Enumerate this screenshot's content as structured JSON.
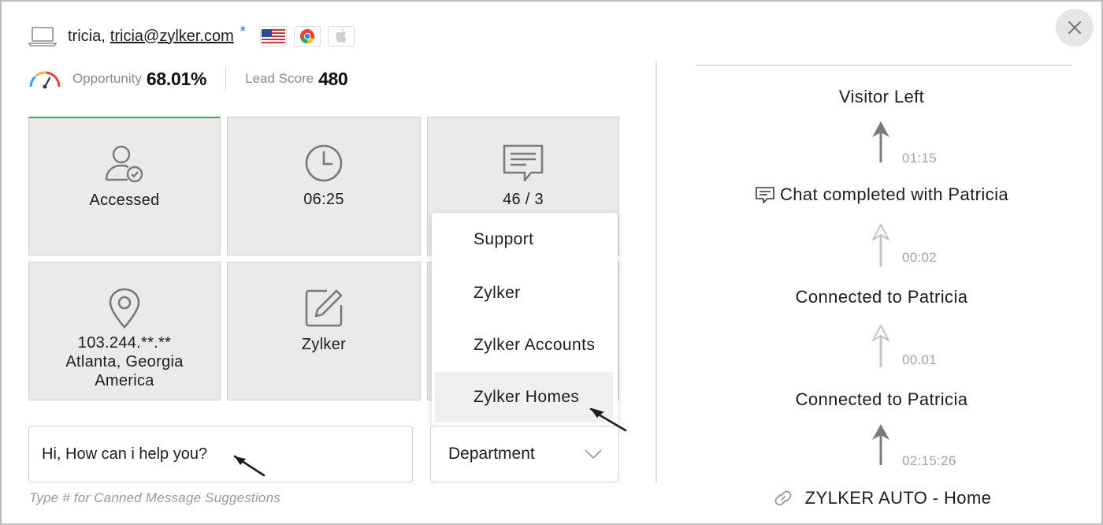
{
  "visitor": {
    "name": "tricia,",
    "email": "tricia@zylker.com",
    "star": "*",
    "icons": [
      "laptop-icon",
      "us-flag-icon",
      "chrome-icon",
      "apple-icon"
    ]
  },
  "metrics": {
    "opportunity_label": "Opportunity",
    "opportunity_value": "68.01%",
    "lead_score_label": "Lead Score",
    "lead_score_value": "480"
  },
  "tiles": [
    {
      "icon": "user-check-icon",
      "text": "Accessed"
    },
    {
      "icon": "clock-icon",
      "text": "06:25"
    },
    {
      "icon": "chat-icon",
      "text": "46 / 3"
    },
    {
      "icon": "location-pin-icon",
      "lines": [
        "103.244.**.**",
        "Atlanta, Georgia",
        "America"
      ]
    },
    {
      "icon": "edit-icon",
      "text": "Zylker"
    }
  ],
  "department_menu": {
    "items": [
      "Support",
      "Zylker",
      "Zylker Accounts",
      "Zylker Homes"
    ],
    "highlighted": "Zylker Homes"
  },
  "composer": {
    "message_value": "Hi, How can i help you?",
    "department_label": "Department",
    "hint": "Type # for Canned Message Suggestions"
  },
  "timeline": {
    "events": [
      {
        "label": "Visitor Left"
      },
      {
        "label": "Chat completed with Patricia",
        "icon": "chat-icon"
      },
      {
        "label": "Connected to Patricia"
      },
      {
        "label": "Connected to Patricia"
      },
      {
        "label": "ZYLKER AUTO - Home",
        "icon": "link-icon"
      }
    ],
    "durations": [
      "01:15",
      "00:02",
      "00.01",
      "02:15:26"
    ]
  },
  "colors": {
    "accent_green": "#2db33d",
    "tile_bg": "#eaeaea",
    "muted_text": "#8a8a8a",
    "star_blue": "#2b6fd6"
  }
}
